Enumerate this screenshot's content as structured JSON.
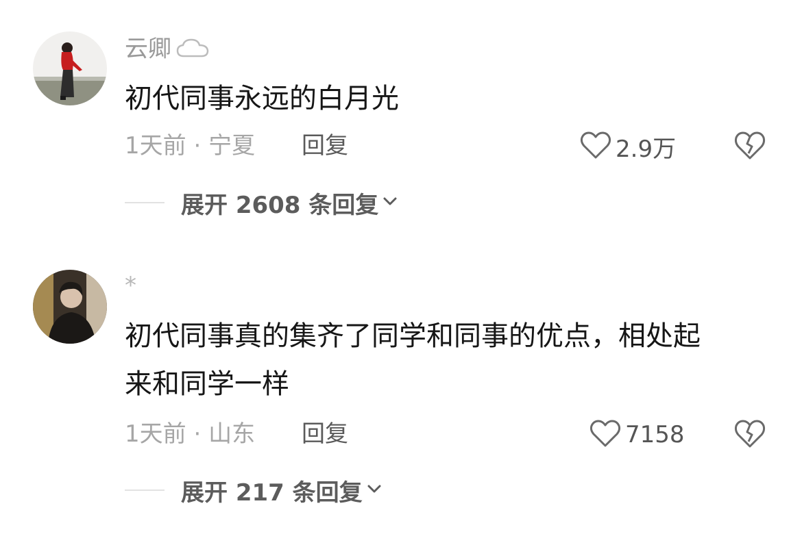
{
  "comments": [
    {
      "username": "云卿",
      "text_lines": [
        "初代同事永远的白月光"
      ],
      "time": "1天前",
      "location": "宁夏",
      "reply_label": "回复",
      "likes": "2.9万",
      "expand_label": "展开 2608 条回复"
    },
    {
      "username": "*",
      "text_lines": [
        "初代同事真的集齐了同学和同事的优点，相处起",
        "来和同学一样"
      ],
      "time": "1天前",
      "location": "山东",
      "reply_label": "回复",
      "likes": "7158",
      "expand_label": "展开 217 条回复"
    }
  ],
  "separator": " · ",
  "colors": {
    "username": "#9a9a9a",
    "text": "#161616",
    "meta": "#a6a6a6",
    "icon": "#6a6a6a"
  },
  "icons": {
    "badge": "cloud-icon",
    "like": "heart-outline-icon",
    "dislike": "broken-heart-icon",
    "expand": "chevron-down-icon"
  }
}
